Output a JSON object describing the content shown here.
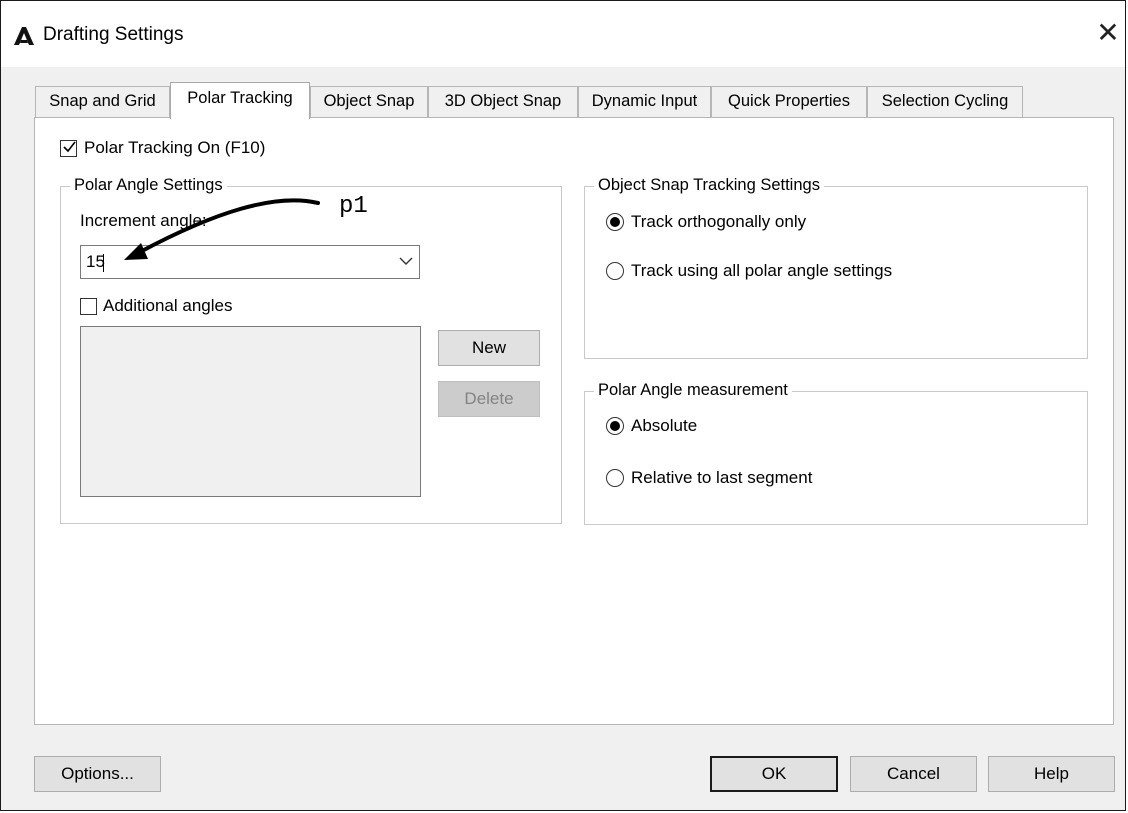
{
  "window": {
    "title": "Drafting Settings",
    "close_glyph": "✕",
    "app_icon": "autocad-a-icon"
  },
  "tabs": [
    {
      "label": "Snap and Grid",
      "active": false
    },
    {
      "label": "Polar Tracking",
      "active": true
    },
    {
      "label": "Object Snap",
      "active": false
    },
    {
      "label": "3D Object Snap",
      "active": false
    },
    {
      "label": "Dynamic Input",
      "active": false
    },
    {
      "label": "Quick Properties",
      "active": false
    },
    {
      "label": "Selection Cycling",
      "active": false
    }
  ],
  "polar_tracking_on": {
    "label": "Polar Tracking On (F10)",
    "checked": true
  },
  "polar_angle_settings": {
    "legend": "Polar Angle Settings",
    "increment_label": "Increment angle:",
    "increment_value": "15",
    "additional_angles": {
      "label": "Additional angles",
      "checked": false
    },
    "new_button": "New",
    "delete_button": "Delete"
  },
  "object_snap_tracking": {
    "legend": "Object Snap Tracking Settings",
    "options": [
      {
        "label": "Track orthogonally only",
        "selected": true
      },
      {
        "label": "Track using all polar angle settings",
        "selected": false
      }
    ]
  },
  "polar_angle_measurement": {
    "legend": "Polar Angle measurement",
    "options": [
      {
        "label": "Absolute",
        "selected": true
      },
      {
        "label": "Relative to last segment",
        "selected": false
      }
    ]
  },
  "footer": {
    "options_button": "Options...",
    "ok_button": "OK",
    "cancel_button": "Cancel",
    "help_button": "Help"
  },
  "annotation": {
    "label": "p1"
  }
}
